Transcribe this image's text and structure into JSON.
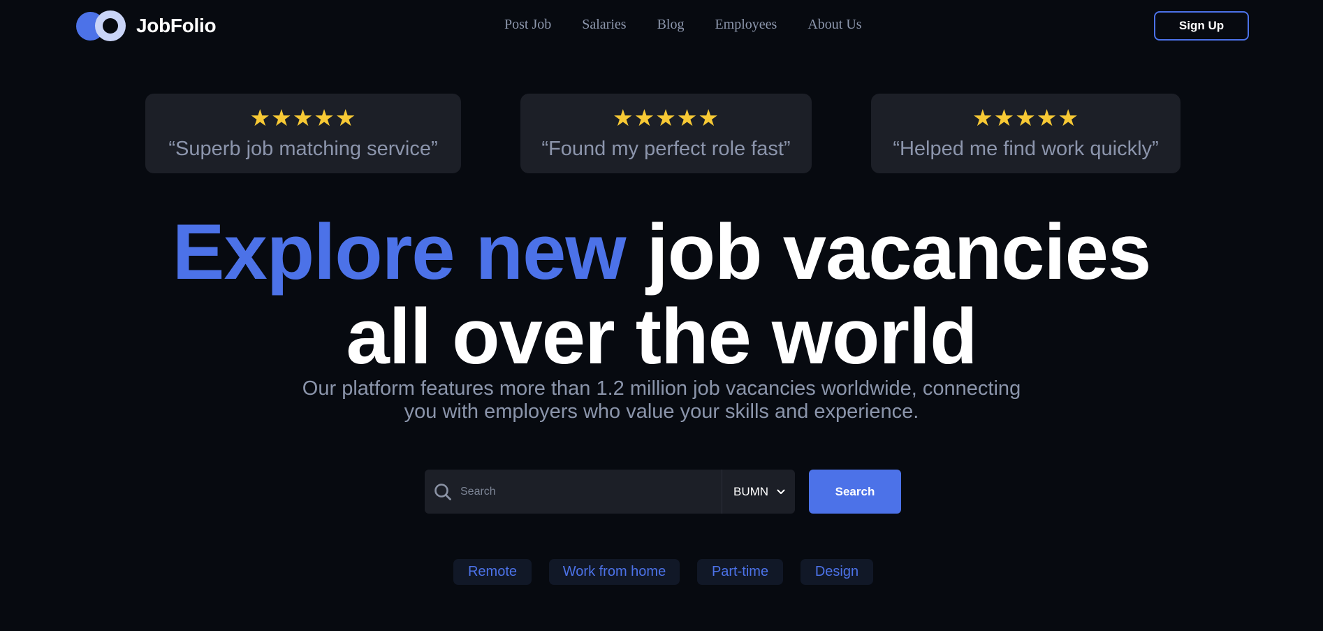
{
  "brand": {
    "name": "JobFolio",
    "logo_icon": "two-circles-logo",
    "accent": "#4c72e8"
  },
  "nav": {
    "links": [
      "Post Job",
      "Salaries",
      "Blog",
      "Employees",
      "About Us"
    ],
    "signup_label": "Sign Up"
  },
  "reviews": [
    {
      "stars": "★★★★★",
      "quote": "“Superb job matching service”"
    },
    {
      "stars": "★★★★★",
      "quote": "“Found my perfect role fast”"
    },
    {
      "stars": "★★★★★",
      "quote": "“Helped me find work quickly”"
    }
  ],
  "hero": {
    "title_accent": "Explore new",
    "title_rest": "job vacancies",
    "title_line2": "all over the world",
    "subtitle_line1": "Our platform features more than 1.2 million job vacancies worldwide, connecting",
    "subtitle_line2": "you with employers who value your skills and experience."
  },
  "search": {
    "placeholder": "Search",
    "value": "",
    "region": "BUMN",
    "button_label": "Search",
    "icons": {
      "search": "search-icon",
      "dropdown": "chevron-down-icon"
    }
  },
  "tags": [
    "Remote",
    "Work from home",
    "Part-time",
    "Design"
  ],
  "colors": {
    "background": "#070a10",
    "card": "#1c1f27",
    "star": "#f7c935",
    "muted_text": "#8b95ab",
    "tag_bg": "#111827"
  }
}
